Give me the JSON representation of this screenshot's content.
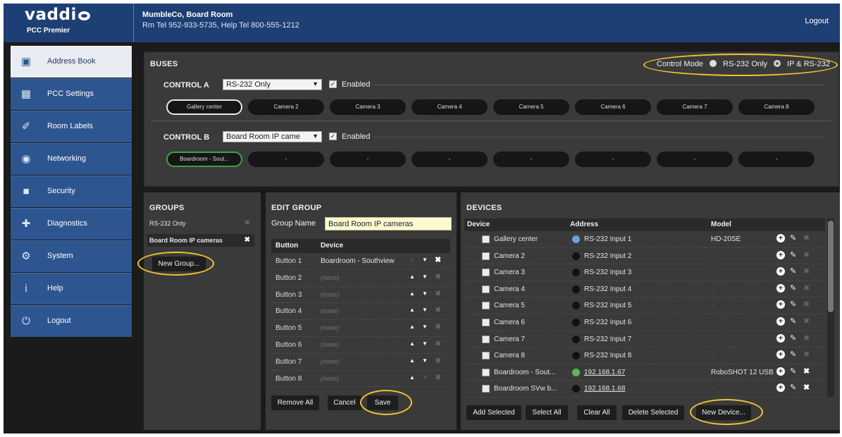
{
  "header": {
    "brand": "vaddi",
    "product": "PCC Premier",
    "site_name": "MumbleCo, Board Room",
    "site_phones": "Rm Tel 952-933-5735, Help Tel 800-555-1212",
    "logout": "Logout"
  },
  "sidebar": {
    "items": [
      {
        "label": "Address Book",
        "icon": "address-book-icon",
        "active": true
      },
      {
        "label": "PCC Settings",
        "icon": "settings-grid-icon"
      },
      {
        "label": "Room Labels",
        "icon": "label-icon"
      },
      {
        "label": "Networking",
        "icon": "network-icon"
      },
      {
        "label": "Security",
        "icon": "lock-icon"
      },
      {
        "label": "Diagnostics",
        "icon": "diagnostics-icon"
      },
      {
        "label": "System",
        "icon": "system-icon"
      },
      {
        "label": "Help",
        "icon": "help-icon"
      },
      {
        "label": "Logout",
        "icon": "power-icon"
      }
    ]
  },
  "buses": {
    "title": "BUSES",
    "control_mode_label": "Control Mode",
    "mode_options": [
      "RS-232 Only",
      "IP & RS-232"
    ],
    "selected_mode": "IP & RS-232",
    "control_a": {
      "label": "CONTROL A",
      "select": "RS-232 Only",
      "enabled_label": "Enabled",
      "buttons": [
        "Gallery center",
        "Camera 2",
        "Camera 3",
        "Camera 4",
        "Camera 5",
        "Camera 6",
        "Camera 7",
        "Camera 8"
      ]
    },
    "control_b": {
      "label": "CONTROL B",
      "select": "Board Room IP came",
      "enabled_label": "Enabled",
      "buttons": [
        "Boardroom - Sout...",
        "-",
        "-",
        "-",
        "-",
        "-",
        "-",
        "-"
      ]
    }
  },
  "groups": {
    "title": "GROUPS",
    "items": [
      "RS-232 Only",
      "Board Room IP cameras"
    ],
    "new_button": "New Group..."
  },
  "edit_group": {
    "title": "EDIT GROUP",
    "name_label": "Group Name",
    "name_value": "Board Room IP cameras",
    "col_button": "Button",
    "col_device": "Device",
    "rows": [
      {
        "button": "Button 1",
        "device": "Boardroom - Southview"
      },
      {
        "button": "Button 2",
        "device": "(none)"
      },
      {
        "button": "Button 3",
        "device": "(none)"
      },
      {
        "button": "Button 4",
        "device": "(none)"
      },
      {
        "button": "Button 5",
        "device": "(none)"
      },
      {
        "button": "Button 6",
        "device": "(none)"
      },
      {
        "button": "Button 7",
        "device": "(none)"
      },
      {
        "button": "Button 8",
        "device": "(none)"
      }
    ],
    "remove_all": "Remove All",
    "cancel": "Cancel",
    "save": "Save"
  },
  "devices": {
    "title": "DEVICES",
    "col_device": "Device",
    "col_address": "Address",
    "col_model": "Model",
    "rows": [
      {
        "name": "Gallery center",
        "address": "RS-232 Input 1",
        "model": "HD-20SE",
        "status": "blue"
      },
      {
        "name": "Camera 2",
        "address": "RS-232 Input 2",
        "model": "-",
        "status": "black"
      },
      {
        "name": "Camera 3",
        "address": "RS-232 Input 3",
        "model": "-",
        "status": "black"
      },
      {
        "name": "Camera 4",
        "address": "RS-232 Input 4",
        "model": "-",
        "status": "black"
      },
      {
        "name": "Camera 5",
        "address": "RS-232 Input 5",
        "model": "-",
        "status": "black"
      },
      {
        "name": "Camera 6",
        "address": "RS-232 Input 6",
        "model": "-",
        "status": "black"
      },
      {
        "name": "Camera 7",
        "address": "RS-232 Input 7",
        "model": "-",
        "status": "black"
      },
      {
        "name": "Camera 8",
        "address": "RS-232 Input 8",
        "model": "-",
        "status": "black"
      },
      {
        "name": "Boardroom - Sout...",
        "address": "192.168.1.67",
        "model": "RoboSHOT 12 USB",
        "status": "green"
      },
      {
        "name": "Boardroom SVw b...",
        "address": "192.168.1.68",
        "model": "-",
        "status": "black"
      }
    ],
    "add_selected": "Add Selected",
    "select_all": "Select All",
    "clear_all": "Clear All",
    "delete_selected": "Delete Selected",
    "new_device": "New Device..."
  },
  "colors": {
    "header_blue": "#1e3f74",
    "nav_blue": "#2d5590",
    "highlight": "#f1c232",
    "panel": "#3a3a3a"
  }
}
